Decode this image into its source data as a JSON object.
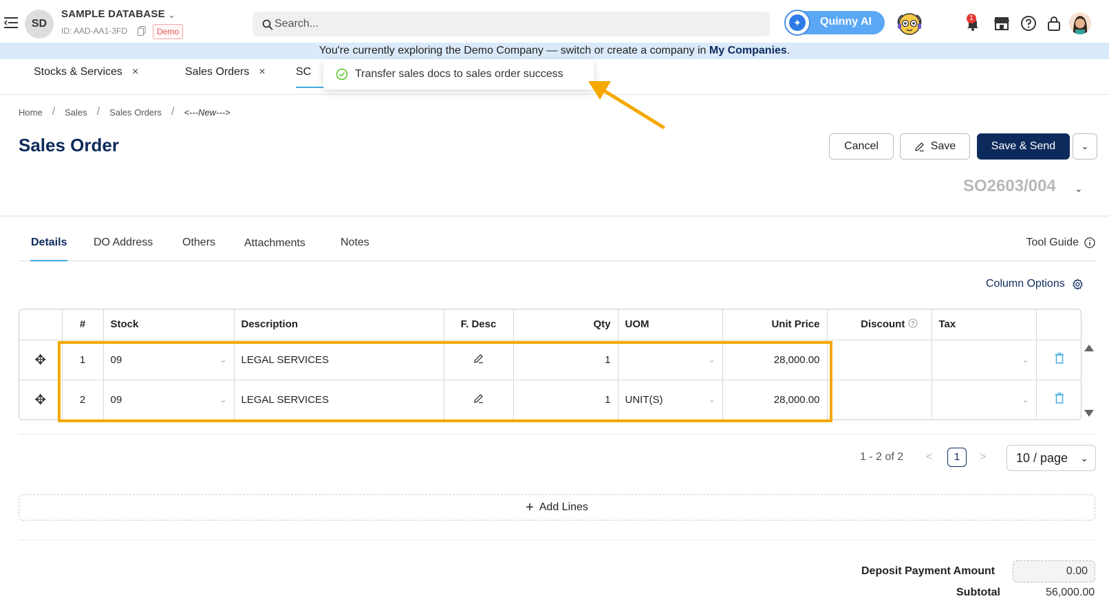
{
  "header": {
    "avatar_initials": "SD",
    "db_name": "SAMPLE DATABASE",
    "db_id": "ID: AAD-AA1-3FD",
    "demo_badge": "Demo",
    "search_placeholder": "Search...",
    "quinny_label": "Quinny AI",
    "notification_count": "1",
    "icons": [
      "menu-icon",
      "copy-icon",
      "search-icon",
      "bot-icon",
      "bell-icon",
      "store-icon",
      "help-icon",
      "lock-icon",
      "user-avatar"
    ]
  },
  "banner": {
    "text": "You're currently exploring the Demo Company — switch or create a company in ",
    "link": "My Companies",
    "suffix": "."
  },
  "doc_tabs": [
    {
      "label": "Stocks & Services",
      "close": "×"
    },
    {
      "label": "Sales Orders",
      "close": "×"
    },
    {
      "label": "SC"
    }
  ],
  "toast": {
    "message": "Transfer sales docs to sales order success"
  },
  "breadcrumb": [
    "Home",
    "Sales",
    "Sales Orders",
    "<---New--->"
  ],
  "page": {
    "title": "Sales Order",
    "doc_number": "SO2603/004"
  },
  "actions": {
    "cancel": "Cancel",
    "save": "Save",
    "save_send": "Save & Send"
  },
  "detail_tabs": [
    "Details",
    "DO Address",
    "Others",
    "Attachments",
    "Notes"
  ],
  "tool_guide": "Tool Guide",
  "column_options": "Column Options",
  "table": {
    "headers": [
      "",
      "#",
      "Stock",
      "Description",
      "F. Desc",
      "Qty",
      "UOM",
      "Unit Price",
      "Discount",
      "Tax",
      ""
    ],
    "rows": [
      {
        "no": "1",
        "stock": "09",
        "description": "LEGAL SERVICES",
        "qty": "1",
        "uom": "",
        "unit_price": "28,000.00",
        "discount": "",
        "tax": ""
      },
      {
        "no": "2",
        "stock": "09",
        "description": "LEGAL SERVICES",
        "qty": "1",
        "uom": "UNIT(S)",
        "unit_price": "28,000.00",
        "discount": "",
        "tax": ""
      }
    ]
  },
  "pagination": {
    "range": "1 - 2 of 2",
    "current_page": "1",
    "page_size": "10 / page"
  },
  "add_lines": "Add Lines",
  "totals": {
    "deposit_label": "Deposit Payment Amount",
    "deposit_value": "0.00",
    "subtotal_label": "Subtotal",
    "subtotal_value": "56,000.00"
  },
  "colors": {
    "brand_navy": "#0d2a5c",
    "accent_blue": "#3fa9e0",
    "highlight_orange": "#f5a800",
    "banner_bg": "#dbeafa"
  }
}
